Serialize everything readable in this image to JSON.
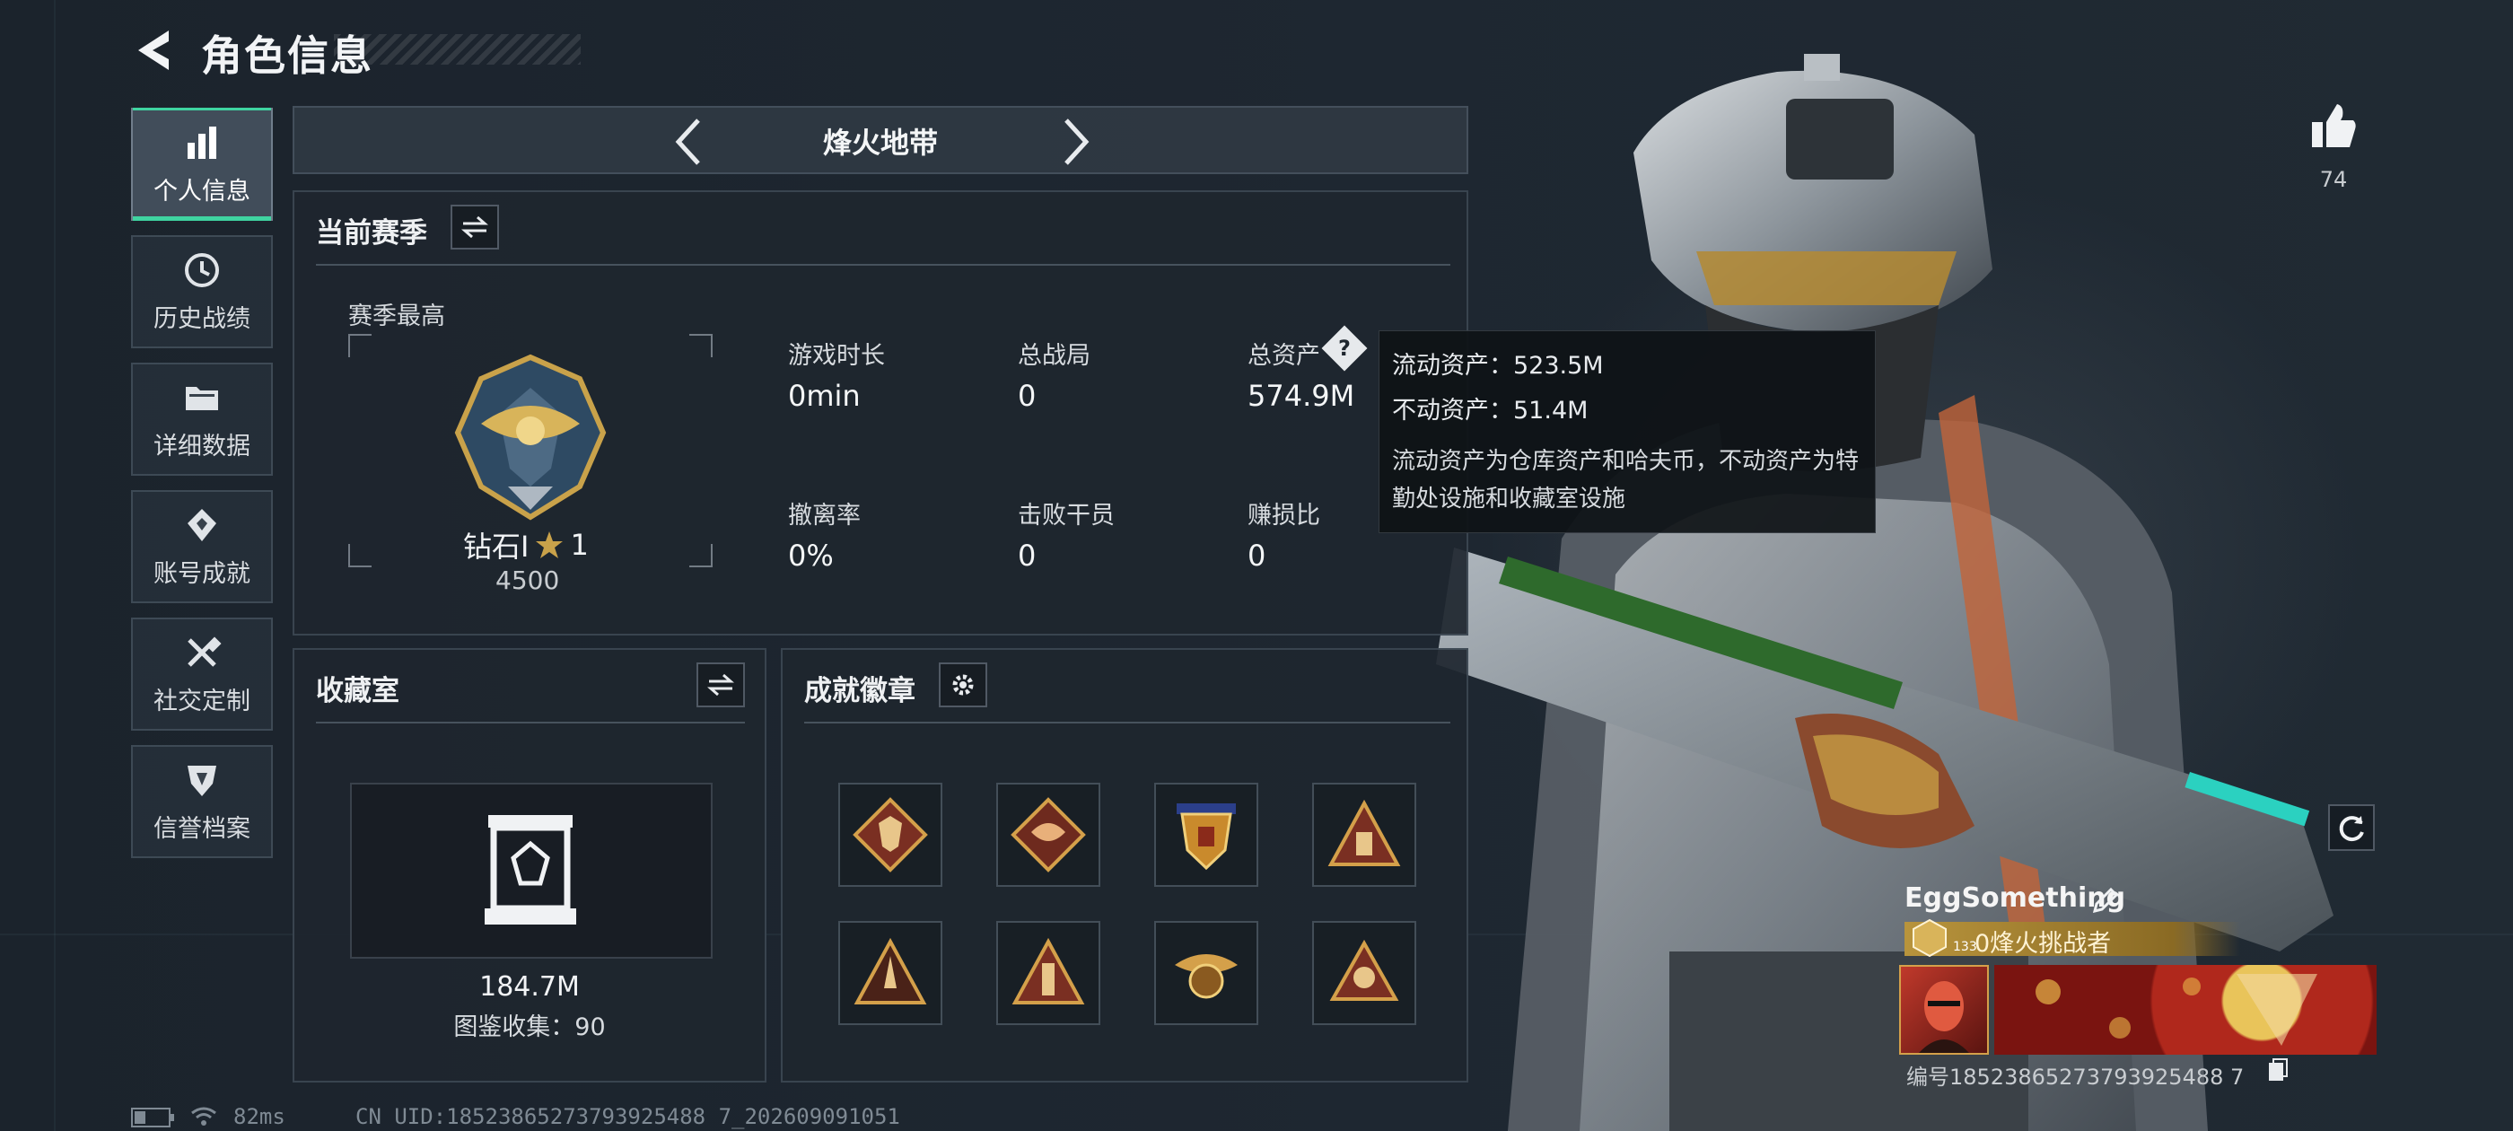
{
  "header": {
    "title": "角色信息"
  },
  "sidebar": {
    "items": [
      {
        "label": "个人信息",
        "icon": "bar-chart-icon",
        "active": true
      },
      {
        "label": "历史战绩",
        "icon": "history-clock-icon"
      },
      {
        "label": "详细数据",
        "icon": "folder-icon"
      },
      {
        "label": "账号成就",
        "icon": "achievement-icon"
      },
      {
        "label": "社交定制",
        "icon": "wrench-tools-icon"
      },
      {
        "label": "信誉档案",
        "icon": "shield-emblem-icon"
      }
    ]
  },
  "mode_selector": {
    "label": "烽火地带"
  },
  "season": {
    "title": "当前赛季",
    "best_label": "赛季最高",
    "rank_name": "钻石I",
    "rank_stars": "1",
    "rank_points": "4500",
    "stats": [
      {
        "label": "游戏时长",
        "value": "0min"
      },
      {
        "label": "总战局",
        "value": "0"
      },
      {
        "label": "总资产",
        "value": "574.9M"
      },
      {
        "label": "撤离率",
        "value": "0%"
      },
      {
        "label": "击败干员",
        "value": "0"
      },
      {
        "label": "赚损比",
        "value": "0"
      }
    ]
  },
  "tooltip": {
    "line1": "流动资产：523.5M",
    "line2": "不动资产：51.4M",
    "description": "流动资产为仓库资产和哈夫币，不动资产为特勤处设施和收藏室设施"
  },
  "collection": {
    "title": "收藏室",
    "value": "184.7M",
    "codex": "图鉴收集：90"
  },
  "achievements": {
    "title": "成就徽章"
  },
  "likes": {
    "count": "74"
  },
  "profile": {
    "name": "EggSomething",
    "level": "133",
    "title": "0烽火挑战者",
    "id_line": "编号18523865273793925488 7"
  },
  "status_bar": {
    "ping": "82ms",
    "uid": "CN UID:18523865273793925488 7_202609091051"
  },
  "colors": {
    "accent": "#3fd4a1",
    "gold": "#c9a24a"
  }
}
